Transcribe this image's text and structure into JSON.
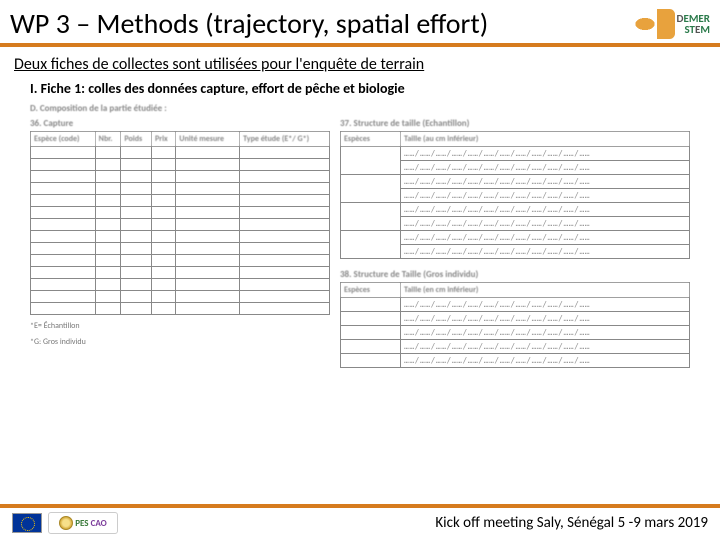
{
  "header": {
    "title": "WP 3 – Methods (trajectory, spatial effort)",
    "logo": {
      "line1_a": "D",
      "line1_b": "EMER",
      "line2_a": "ST",
      "line2_b": "E",
      "line2_c": "M"
    }
  },
  "intro": "Deux fiches de collectes sont utilisées pour l'enquête de terrain",
  "fiche": "I.  Fiche 1: colles des données capture, effort de pêche et biologie",
  "form": {
    "sectionD": "D. Composition de la partie étudiée :",
    "capture": {
      "caption": "36. Capture",
      "headers": [
        "Espèce (code)",
        "Nbr.",
        "Poids",
        "Prix",
        "Unité mesure",
        "Type étude (E*/ G*)"
      ]
    },
    "taille1": {
      "caption": "37. Structure de taille (Echantillon)",
      "headers": [
        "Espèces",
        "Taille (au cm inférieur)"
      ],
      "dots": "……/……/……/……/……/……/……/……/……/……/……/……"
    },
    "taille2": {
      "caption": "38. Structure de Taille (Gros individu)",
      "headers": [
        "Espèces",
        "Taille (en cm inférieur)"
      ],
      "dots": "……/……/……/……/……/……/……/……/……/……/……/……"
    },
    "footnote1": "*E= Échantillon",
    "footnote2": "*G: Gros individu"
  },
  "footer": {
    "pes": "PES",
    "cao": "CAO",
    "text": "Kick off meeting Saly, Sénégal 5 -9 mars 2019"
  }
}
